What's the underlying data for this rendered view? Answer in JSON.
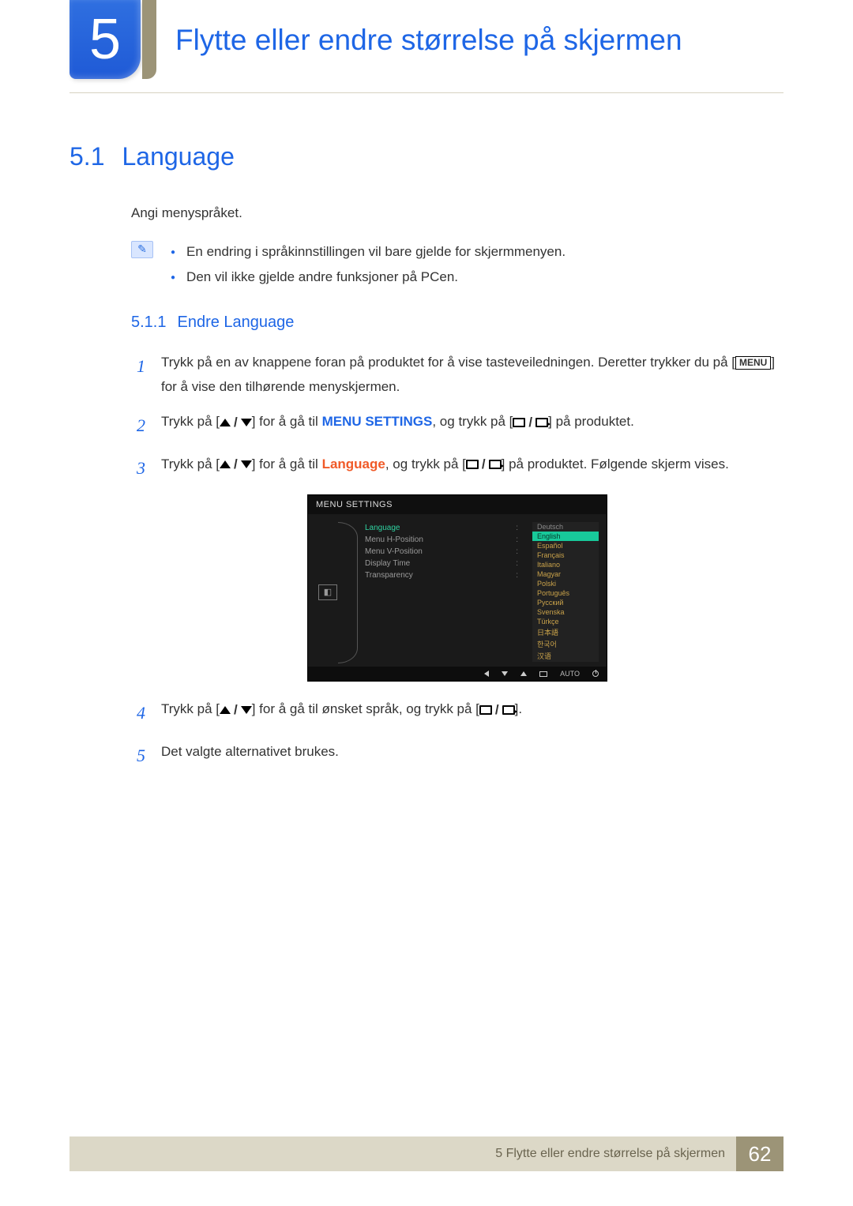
{
  "chapter": {
    "number": "5",
    "title": "Flytte eller endre størrelse på skjermen"
  },
  "section": {
    "number": "5.1",
    "title": "Language",
    "intro": "Angi menyspråket.",
    "notes": [
      "En endring i språkinnstillingen vil bare gjelde for skjermmenyen.",
      "Den vil ikke gjelde andre funksjoner på PCen."
    ]
  },
  "subsection": {
    "number": "5.1.1",
    "title": "Endre Language"
  },
  "steps": {
    "s1a": "Trykk på en av knappene foran på produktet for å vise tasteveiledningen. Deretter trykker du på ",
    "s1b": " for å vise den tilhørende menyskjermen.",
    "menu_badge": "MENU",
    "s2a": "Trykk på [",
    "s2b": "] for å gå til ",
    "s2_target": "MENU SETTINGS",
    "s2c": ", og trykk på [",
    "s2d": "] på produktet.",
    "s3a": "Trykk på [",
    "s3b": "] for å gå til ",
    "s3_target": "Language",
    "s3c": ", og trykk på [",
    "s3d": "] på produktet. Følgende skjerm vises.",
    "s4a": "Trykk på [",
    "s4b": "] for å gå til ønsket språk, og trykk på [",
    "s4c": "].",
    "s5": "Det valgte alternativet brukes."
  },
  "osd": {
    "title": "MENU SETTINGS",
    "menu_items": [
      {
        "label": "Language",
        "active": true
      },
      {
        "label": "Menu H-Position",
        "active": false
      },
      {
        "label": "Menu V-Position",
        "active": false
      },
      {
        "label": "Display Time",
        "active": false
      },
      {
        "label": "Transparency",
        "active": false
      }
    ],
    "languages": [
      {
        "label": "Deutsch",
        "state": "dim"
      },
      {
        "label": "English",
        "state": "hl"
      },
      {
        "label": "Español",
        "state": "normal"
      },
      {
        "label": "Français",
        "state": "normal"
      },
      {
        "label": "Italiano",
        "state": "normal"
      },
      {
        "label": "Magyar",
        "state": "normal"
      },
      {
        "label": "Polski",
        "state": "normal"
      },
      {
        "label": "Português",
        "state": "normal"
      },
      {
        "label": "Русский",
        "state": "normal"
      },
      {
        "label": "Svenska",
        "state": "normal"
      },
      {
        "label": "Türkçe",
        "state": "normal"
      },
      {
        "label": "日本語",
        "state": "normal"
      },
      {
        "label": "한국어",
        "state": "normal"
      },
      {
        "label": "汉语",
        "state": "normal"
      }
    ],
    "footer_auto": "AUTO"
  },
  "footer": {
    "text": "5 Flytte eller endre størrelse på skjermen",
    "page": "62"
  }
}
